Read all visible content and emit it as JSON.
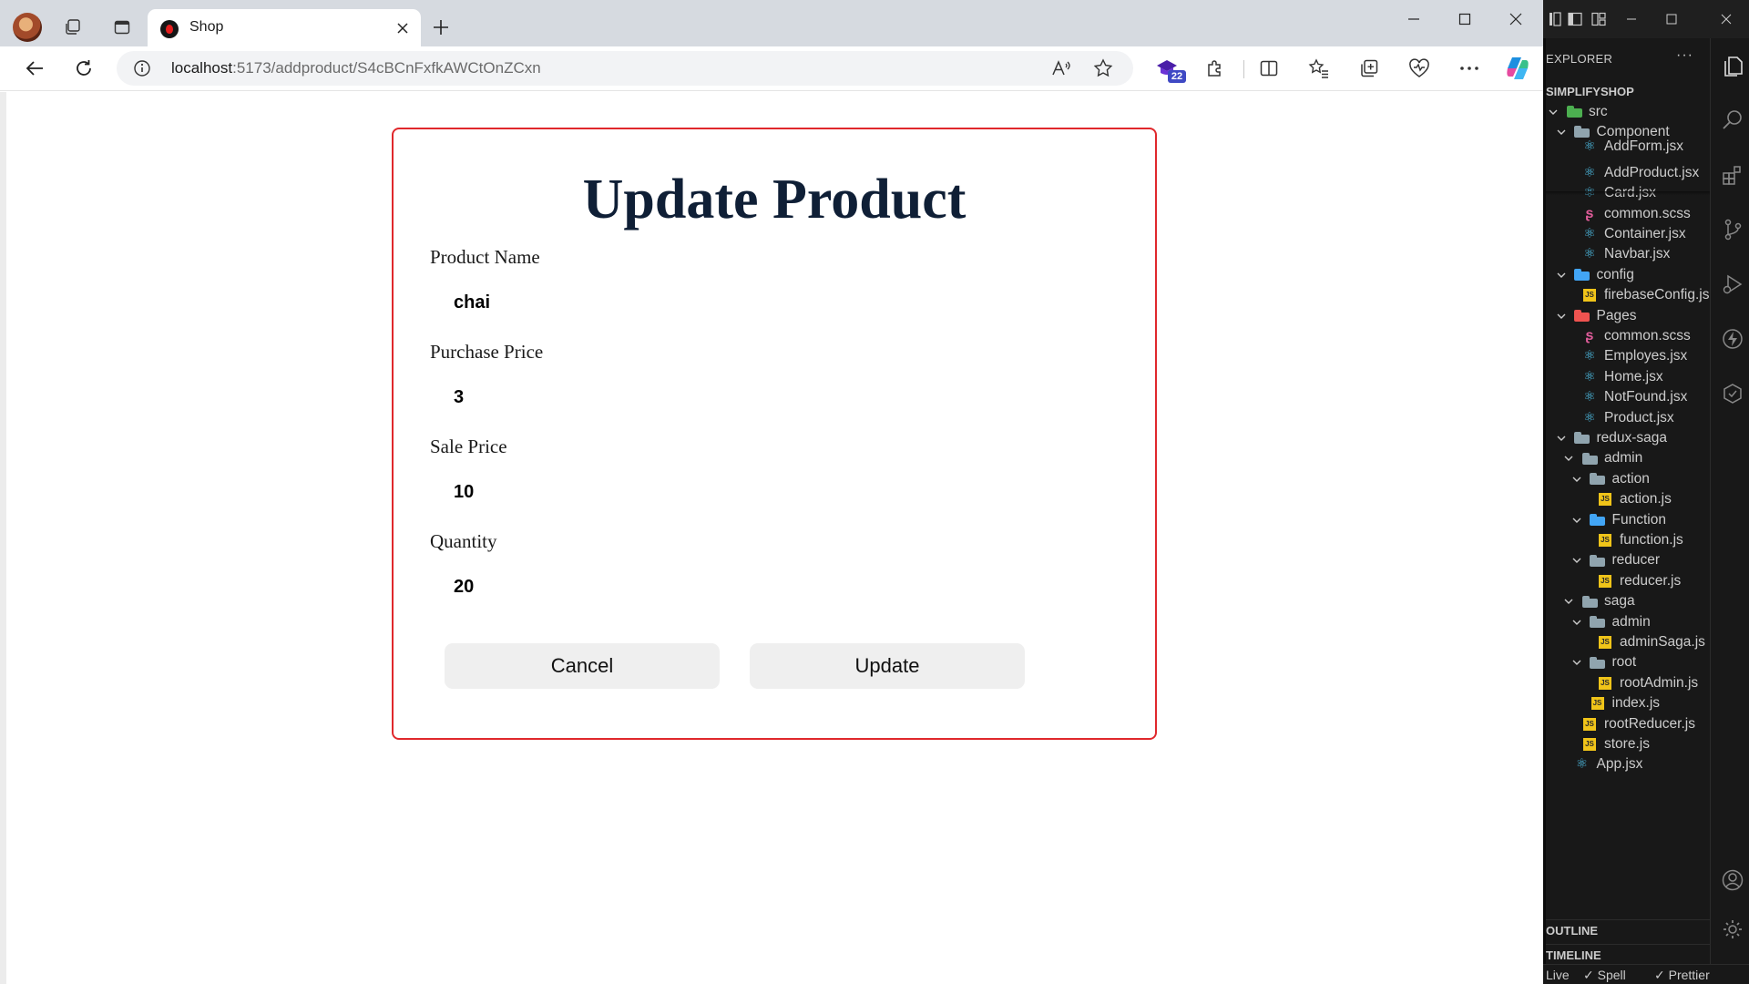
{
  "browser": {
    "tab": {
      "title": "Shop"
    },
    "address": {
      "host": "localhost",
      "path": ":5173/addproduct/S4cBCnFxfkAWCtOnZCxn"
    },
    "extension_badge": "22"
  },
  "page": {
    "title": "Update Product",
    "fields": [
      {
        "label": "Product Name",
        "value": "chai"
      },
      {
        "label": "Purchase Price",
        "value": "3"
      },
      {
        "label": "Sale Price",
        "value": "10"
      },
      {
        "label": "Quantity",
        "value": "20"
      }
    ],
    "buttons": {
      "cancel": "Cancel",
      "update": "Update"
    }
  },
  "colors": {
    "card_border": "#e0282c",
    "title": "#0f1f36",
    "button_bg": "#efefef"
  },
  "vscode": {
    "explorer_title": "EXPLORER",
    "more": "···",
    "workspace": "SIMPLIFYSHOP",
    "tree": [
      {
        "label": "src",
        "type": "folder",
        "depth": 0,
        "open": true,
        "icon_color": "#4caf50"
      },
      {
        "label": "Component",
        "type": "folder",
        "depth": 1,
        "open": true,
        "icon_color": "#90a4ae"
      },
      {
        "label": "AddForm.jsx",
        "type": "react",
        "depth": 2
      },
      {
        "label": "AddProduct.jsx",
        "type": "react",
        "depth": 2
      },
      {
        "label": "Card.jsx",
        "type": "react",
        "depth": 2
      },
      {
        "label": "common.scss",
        "type": "scss",
        "depth": 2
      },
      {
        "label": "Container.jsx",
        "type": "react",
        "depth": 2
      },
      {
        "label": "Navbar.jsx",
        "type": "react",
        "depth": 2
      },
      {
        "label": "config",
        "type": "folder",
        "depth": 1,
        "open": true,
        "icon_color": "#42a5f5"
      },
      {
        "label": "firebaseConfig.js",
        "type": "js",
        "depth": 2
      },
      {
        "label": "Pages",
        "type": "folder",
        "depth": 1,
        "open": true,
        "icon_color": "#ef5350"
      },
      {
        "label": "common.scss",
        "type": "scss",
        "depth": 2
      },
      {
        "label": "Employes.jsx",
        "type": "react",
        "depth": 2
      },
      {
        "label": "Home.jsx",
        "type": "react",
        "depth": 2
      },
      {
        "label": "NotFound.jsx",
        "type": "react",
        "depth": 2
      },
      {
        "label": "Product.jsx",
        "type": "react",
        "depth": 2
      },
      {
        "label": "redux-saga",
        "type": "folder",
        "depth": 1,
        "open": true,
        "icon_color": "#90a4ae"
      },
      {
        "label": "admin",
        "type": "folder",
        "depth": 2,
        "open": true,
        "icon_color": "#90a4ae"
      },
      {
        "label": "action",
        "type": "folder",
        "depth": 3,
        "open": true,
        "icon_color": "#90a4ae"
      },
      {
        "label": "action.js",
        "type": "js",
        "depth": 4
      },
      {
        "label": "Function",
        "type": "folder",
        "depth": 3,
        "open": true,
        "icon_color": "#42a5f5"
      },
      {
        "label": "function.js",
        "type": "js",
        "depth": 4
      },
      {
        "label": "reducer",
        "type": "folder",
        "depth": 3,
        "open": true,
        "icon_color": "#90a4ae"
      },
      {
        "label": "reducer.js",
        "type": "js",
        "depth": 4
      },
      {
        "label": "saga",
        "type": "folder",
        "depth": 2,
        "open": true,
        "icon_color": "#90a4ae"
      },
      {
        "label": "admin",
        "type": "folder",
        "depth": 3,
        "open": true,
        "icon_color": "#90a4ae"
      },
      {
        "label": "adminSaga.js",
        "type": "js",
        "depth": 4
      },
      {
        "label": "root",
        "type": "folder",
        "depth": 3,
        "open": true,
        "icon_color": "#90a4ae"
      },
      {
        "label": "rootAdmin.js",
        "type": "js",
        "depth": 4
      },
      {
        "label": "index.js",
        "type": "js",
        "depth": 3
      },
      {
        "label": "rootReducer.js",
        "type": "js",
        "depth": 2
      },
      {
        "label": "store.js",
        "type": "js",
        "depth": 2
      },
      {
        "label": "App.jsx",
        "type": "react",
        "depth": 1
      }
    ],
    "outline": "OUTLINE",
    "timeline": "TIMELINE",
    "status": {
      "live": "Live",
      "spell": "✓ Spell",
      "prettier": "✓ Prettier"
    }
  }
}
